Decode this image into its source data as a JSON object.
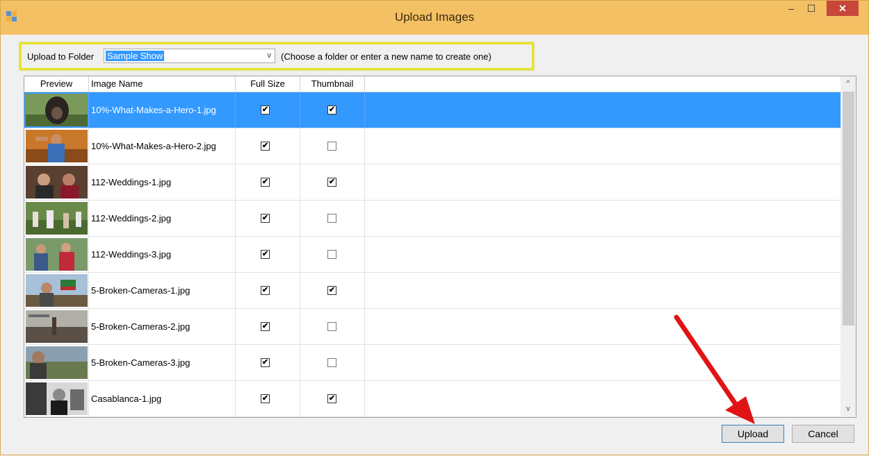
{
  "window": {
    "title": "Upload Images",
    "minimize_glyph": "–",
    "maximize_glyph": "☐",
    "close_glyph": "✕",
    "app_icon": "form-app-icon"
  },
  "folder": {
    "label": "Upload to Folder",
    "selected_value": "Sample Show",
    "dropdown_glyph": "v",
    "hint": "(Choose a folder or enter a new name to create one)",
    "highlight_color": "#e6e32a"
  },
  "grid": {
    "columns": [
      "Preview",
      "Image Name",
      "Full Size",
      "Thumbnail"
    ],
    "rows": [
      {
        "name": "10%-What-Makes-a-Hero-1.jpg",
        "full_size": "✔",
        "thumbnail": "✔",
        "selected": true
      },
      {
        "name": "10%-What-Makes-a-Hero-2.jpg",
        "full_size": "✔",
        "thumbnail": ""
      },
      {
        "name": "112-Weddings-1.jpg",
        "full_size": "✔",
        "thumbnail": "✔"
      },
      {
        "name": "112-Weddings-2.jpg",
        "full_size": "✔",
        "thumbnail": ""
      },
      {
        "name": "112-Weddings-3.jpg",
        "full_size": "✔",
        "thumbnail": ""
      },
      {
        "name": "5-Broken-Cameras-1.jpg",
        "full_size": "✔",
        "thumbnail": "✔"
      },
      {
        "name": "5-Broken-Cameras-2.jpg",
        "full_size": "✔",
        "thumbnail": ""
      },
      {
        "name": "5-Broken-Cameras-3.jpg",
        "full_size": "✔",
        "thumbnail": ""
      },
      {
        "name": "Casablanca-1.jpg",
        "full_size": "✔",
        "thumbnail": "✔"
      }
    ],
    "scroll_up_glyph": "^",
    "scroll_down_glyph": "v"
  },
  "buttons": {
    "upload": "Upload",
    "cancel": "Cancel"
  },
  "colors": {
    "title_bar": "#f4c064",
    "selection": "#3399ff",
    "close_button": "#c7473b",
    "annotation_arrow": "#e01414"
  }
}
